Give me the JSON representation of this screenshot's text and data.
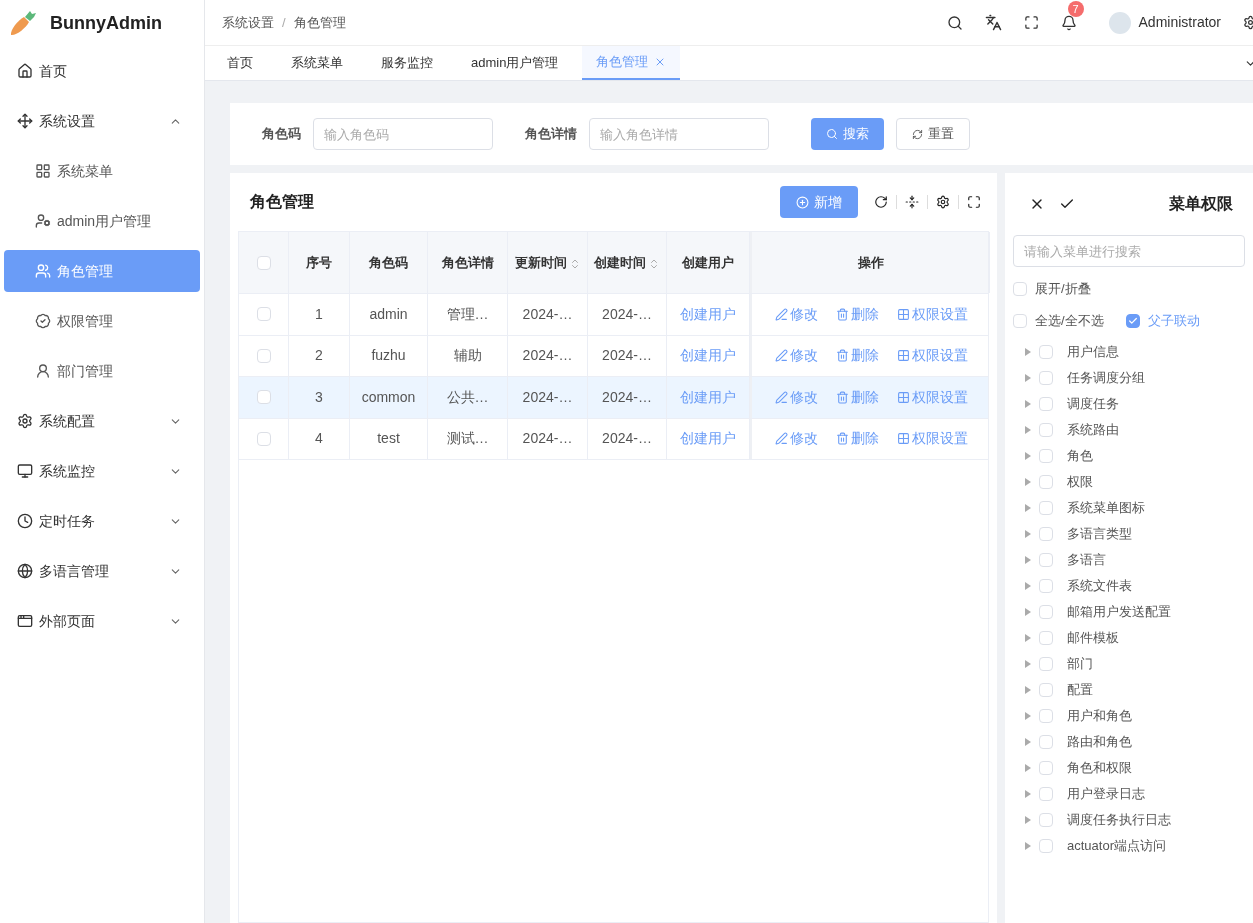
{
  "brand": {
    "name": "BunnyAdmin"
  },
  "sidebar": {
    "items": [
      {
        "kind": "item",
        "label": "首页",
        "selected": false
      },
      {
        "kind": "group",
        "label": "系统设置",
        "expanded": true,
        "children": [
          {
            "label": "系统菜单",
            "selected": false
          },
          {
            "label": "admin用户管理",
            "selected": false
          },
          {
            "label": "角色管理",
            "selected": true
          },
          {
            "label": "权限管理",
            "selected": false
          },
          {
            "label": "部门管理",
            "selected": false
          }
        ]
      },
      {
        "kind": "group",
        "label": "系统配置",
        "expanded": false
      },
      {
        "kind": "group",
        "label": "系统监控",
        "expanded": false
      },
      {
        "kind": "group",
        "label": "定时任务",
        "expanded": false
      },
      {
        "kind": "group",
        "label": "多语言管理",
        "expanded": false
      },
      {
        "kind": "group",
        "label": "外部页面",
        "expanded": false
      }
    ]
  },
  "header": {
    "breadcrumb": [
      "系统设置",
      "角色管理"
    ],
    "separator": "/",
    "notifications": "7",
    "user": "Administrator"
  },
  "tabs": [
    {
      "label": "首页",
      "selected": false
    },
    {
      "label": "系统菜单",
      "selected": false
    },
    {
      "label": "服务监控",
      "selected": false
    },
    {
      "label": "admin用户管理",
      "selected": false
    },
    {
      "label": "角色管理",
      "selected": true
    }
  ],
  "search": {
    "fields": [
      {
        "label": "角色码",
        "placeholder": "输入角色码"
      },
      {
        "label": "角色详情",
        "placeholder": "输入角色详情"
      }
    ],
    "search_button": "搜索",
    "reset_button": "重置"
  },
  "table": {
    "title": "角色管理",
    "add_button": "新增",
    "all_checked": false,
    "columns": [
      {
        "label": "序号",
        "sortable": false
      },
      {
        "label": "角色码",
        "sortable": false
      },
      {
        "label": "角色详情",
        "sortable": false
      },
      {
        "label": "更新时间",
        "sortable": true
      },
      {
        "label": "创建时间",
        "sortable": true
      },
      {
        "label": "创建用户",
        "sortable": false
      },
      {
        "label": "操作",
        "sortable": false
      }
    ],
    "rows": [
      {
        "index": "1",
        "code": "admin",
        "detail": "管理…",
        "updated": "2024-…",
        "created": "2024-…",
        "creator": "创建用户",
        "selected": false,
        "checked": false,
        "actions": [
          "修改",
          "删除",
          "权限设置"
        ]
      },
      {
        "index": "2",
        "code": "fuzhu",
        "detail": "辅助",
        "updated": "2024-…",
        "created": "2024-…",
        "creator": "创建用户",
        "selected": false,
        "checked": false,
        "actions": [
          "修改",
          "删除",
          "权限设置"
        ]
      },
      {
        "index": "3",
        "code": "common",
        "detail": "公共…",
        "updated": "2024-…",
        "created": "2024-…",
        "creator": "创建用户",
        "selected": true,
        "checked": false,
        "actions": [
          "修改",
          "删除",
          "权限设置"
        ]
      },
      {
        "index": "4",
        "code": "test",
        "detail": "测试…",
        "updated": "2024-…",
        "created": "2024-…",
        "creator": "创建用户",
        "selected": false,
        "checked": false,
        "actions": [
          "修改",
          "删除",
          "权限设置"
        ]
      }
    ]
  },
  "permissions": {
    "title": "菜单权限",
    "placeholder": "请输入菜单进行搜索",
    "options": [
      {
        "label": "展开/折叠",
        "checked": false
      },
      {
        "label": "全选/全不选",
        "checked": false
      },
      {
        "label": "父子联动",
        "checked": true
      }
    ],
    "tree": [
      {
        "label": "用户信息",
        "checked": false
      },
      {
        "label": "任务调度分组",
        "checked": false
      },
      {
        "label": "调度任务",
        "checked": false
      },
      {
        "label": "系统路由",
        "checked": false
      },
      {
        "label": "角色",
        "checked": false
      },
      {
        "label": "权限",
        "checked": false
      },
      {
        "label": "系统菜单图标",
        "checked": false
      },
      {
        "label": "多语言类型",
        "checked": false
      },
      {
        "label": "多语言",
        "checked": false
      },
      {
        "label": "系统文件表",
        "checked": false
      },
      {
        "label": "邮箱用户发送配置",
        "checked": false
      },
      {
        "label": "邮件模板",
        "checked": false
      },
      {
        "label": "部门",
        "checked": false
      },
      {
        "label": "配置",
        "checked": false
      },
      {
        "label": "用户和角色",
        "checked": false
      },
      {
        "label": "路由和角色",
        "checked": false
      },
      {
        "label": "角色和权限",
        "checked": false
      },
      {
        "label": "用户登录日志",
        "checked": false
      },
      {
        "label": "调度任务执行日志",
        "checked": false
      },
      {
        "label": "actuator端点访问",
        "checked": false
      }
    ]
  }
}
